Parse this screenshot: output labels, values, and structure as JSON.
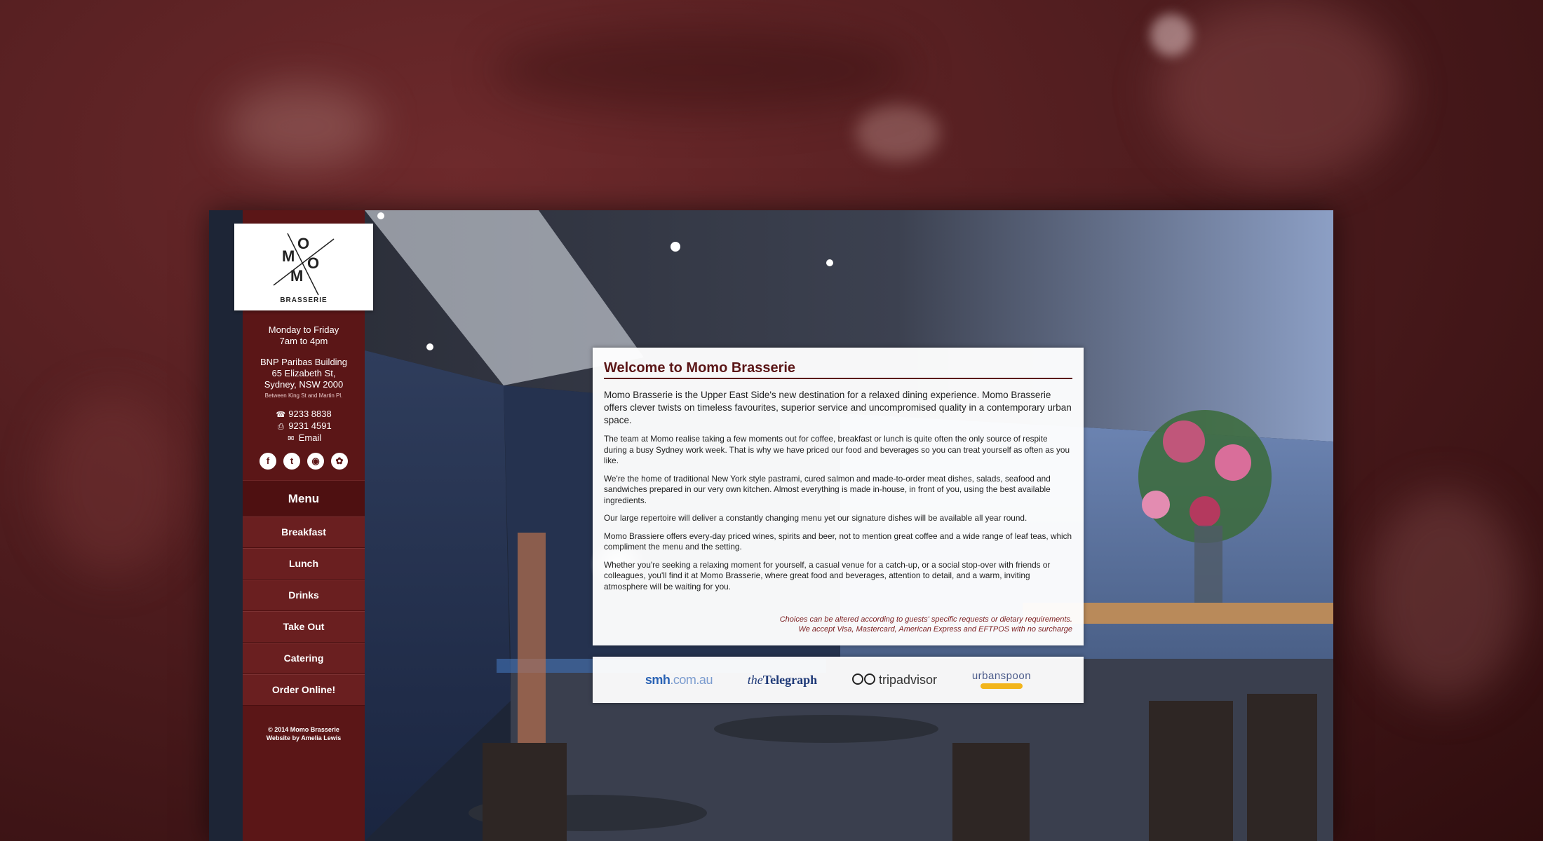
{
  "colors": {
    "brand": "#5b1617",
    "backdrop": "#4a1a1c",
    "accent_italic": "#7a1c1e"
  },
  "logo": {
    "letters": [
      "M",
      "O",
      "M",
      "O"
    ],
    "word": "BRASSERIE"
  },
  "hours": {
    "days": "Monday to Friday",
    "time": "7am to 4pm"
  },
  "address": {
    "line1": "BNP Paribas Building",
    "line2": "65 Elizabeth St,",
    "line3": "Sydney, NSW 2000",
    "between": "Between King St and Martin Pl."
  },
  "contact": {
    "phone_icon": "phone-icon",
    "phone": "9233 8838",
    "fax_icon": "fax-icon",
    "fax": "9231 4591",
    "email_icon": "envelope-icon",
    "email": "Email"
  },
  "social": [
    "facebook-icon",
    "twitter-icon",
    "instagram-icon",
    "foursquare-icon"
  ],
  "menu": {
    "heading": "Menu",
    "items": [
      "Breakfast",
      "Lunch",
      "Drinks",
      "Take Out",
      "Catering",
      "Order Online!"
    ]
  },
  "footer": {
    "copyright": "© 2014 Momo Brasserie",
    "credit": "Website by Amelia Lewis"
  },
  "welcome": {
    "title": "Welcome to Momo Brasserie",
    "lead": "Momo Brasserie is the Upper East Side's new destination for a relaxed dining experience. Momo Brasserie offers clever twists on timeless favourites, superior service and uncompromised quality in a contemporary urban space.",
    "p1": "The team at Momo realise taking a few moments out for coffee, breakfast or lunch is quite often the only source of respite during a busy Sydney work week. That is why we have priced our food and beverages so you can treat yourself as often as you like.",
    "p2": "We're the home of traditional New York style pastrami, cured salmon and made-to-order meat dishes, salads, seafood and sandwiches prepared in our very own kitchen. Almost everything is made in-house, in front of you, using the best available ingredients.",
    "p3": "Our large repertoire will deliver a constantly changing menu yet our signature dishes will be available all year round.",
    "p4": "Momo Brassiere offers every-day priced wines, spirits and beer, not to mention great coffee and a wide range of leaf teas, which compliment the menu and the setting.",
    "p5": "Whether you're seeking a relaxing moment for yourself, a casual venue for a catch-up, or a social stop-over with friends or colleagues, you'll find it at Momo Brasserie, where great food and beverages, attention to detail, and a warm, inviting atmosphere will be waiting for you.",
    "note1": "Choices can be altered according to guests' specific requests or dietary requirements.",
    "note2": "We accept Visa, Mastercard, American Express and EFTPOS with no surcharge"
  },
  "press": {
    "smh_main": "smh",
    "smh_dim": ".com.au",
    "tel_the": "the",
    "tel_name": "Telegraph",
    "trip": "tripadvisor",
    "urban": "urbanspoon"
  }
}
